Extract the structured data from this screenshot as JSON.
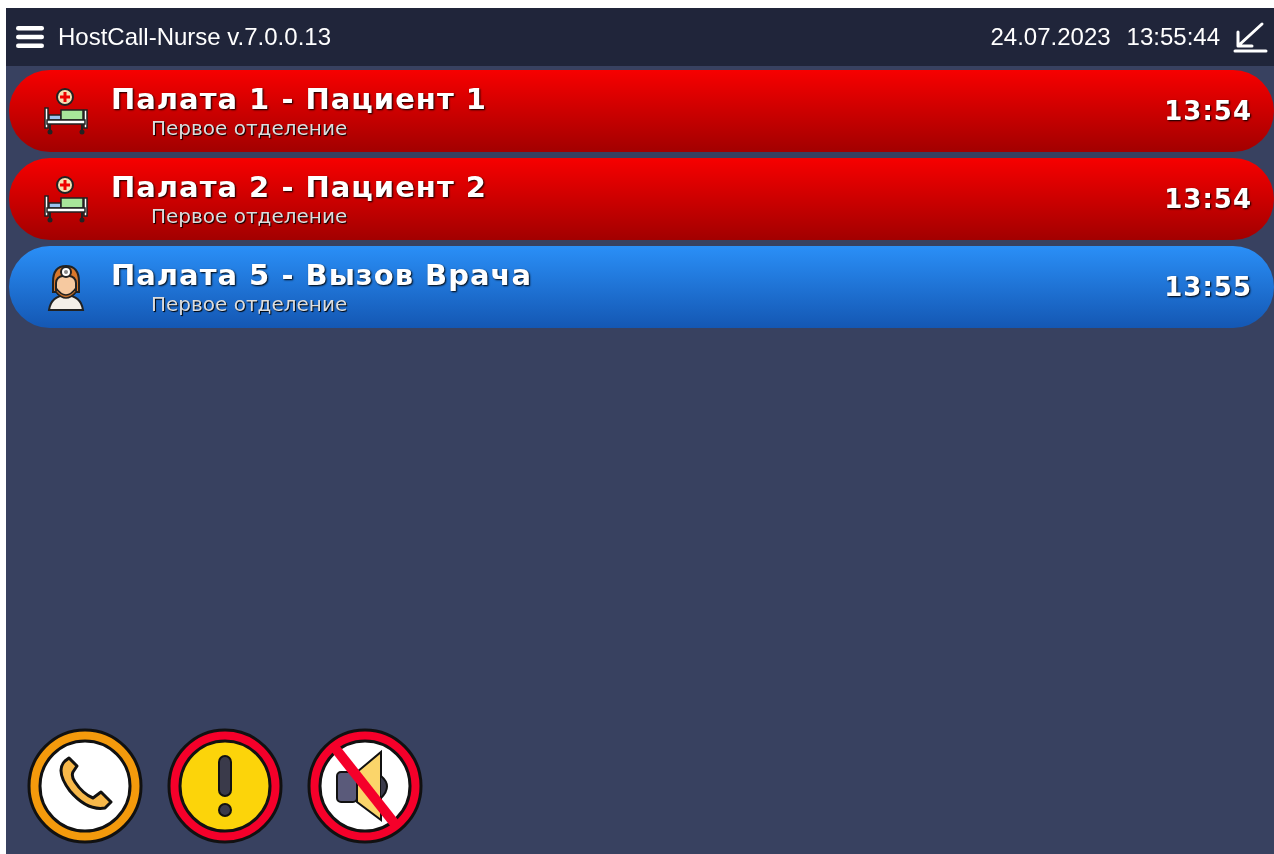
{
  "header": {
    "title": "HostCall-Nurse v.7.0.0.13",
    "date": "24.07.2023",
    "time": "13:55:44"
  },
  "calls": [
    {
      "kind": "patient",
      "title": "Палата 1 - Пациент 1",
      "department": "Первое отделение",
      "time": "13:54"
    },
    {
      "kind": "patient",
      "title": "Палата 2 - Пациент 2",
      "department": "Первое отделение",
      "time": "13:54"
    },
    {
      "kind": "doctor",
      "title": "Палата 5 - Вызов Врача",
      "department": "Первое отделение",
      "time": "13:55"
    }
  ],
  "actions": [
    {
      "kind": "phone"
    },
    {
      "kind": "alert"
    },
    {
      "kind": "mute"
    }
  ]
}
